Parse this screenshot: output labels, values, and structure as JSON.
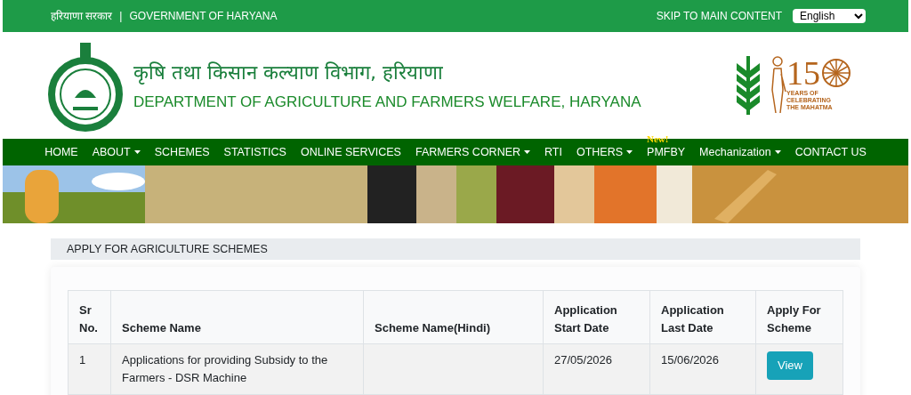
{
  "top_bar": {
    "hindi": "हरियाणा सरकार",
    "separator": "|",
    "government": "GOVERNMENT OF HARYANA",
    "skip_link": "SKIP TO MAIN CONTENT",
    "language": "English"
  },
  "header": {
    "title_hindi": "कृषि तथा किसान कल्याण विभाग, हरियाणा",
    "title": "DEPARTMENT OF AGRICULTURE AND FARMERS WELFARE, HARYANA",
    "anniversary": {
      "number": "15",
      "caption": [
        "YEARS OF",
        "CELEBRATING",
        "THE MAHATMA"
      ]
    }
  },
  "nav": [
    {
      "label": "HOME",
      "has_menu": false
    },
    {
      "label": "ABOUT",
      "has_menu": true
    },
    {
      "label": "SCHEMES",
      "has_menu": false
    },
    {
      "label": "STATISTICS",
      "has_menu": false
    },
    {
      "label": "ONLINE SERVICES",
      "has_menu": false
    },
    {
      "label": "FARMERS CORNER",
      "has_menu": true
    },
    {
      "label": "RTI",
      "has_menu": false
    },
    {
      "label": "OTHERS",
      "has_menu": true
    },
    {
      "label": "PMFBY",
      "has_menu": false,
      "badge": "New!"
    },
    {
      "label": "Mechanization",
      "has_menu": true
    },
    {
      "label": "CONTACT US",
      "has_menu": false
    }
  ],
  "section_title": "APPLY FOR AGRICULTURE SCHEMES",
  "table": {
    "columns": [
      [
        "Sr",
        "No."
      ],
      [
        "Scheme Name"
      ],
      [
        "Scheme Name(Hindi)"
      ],
      [
        "Application",
        "Start Date"
      ],
      [
        "Application",
        "Last Date"
      ],
      [
        "Apply For",
        "Scheme"
      ]
    ],
    "rows": [
      {
        "sr": "1",
        "name": "Applications for providing Subsidy to the Farmers - DSR Machine",
        "start": "27/05/2026",
        "last": "15/06/2026",
        "action": "View"
      }
    ]
  }
}
